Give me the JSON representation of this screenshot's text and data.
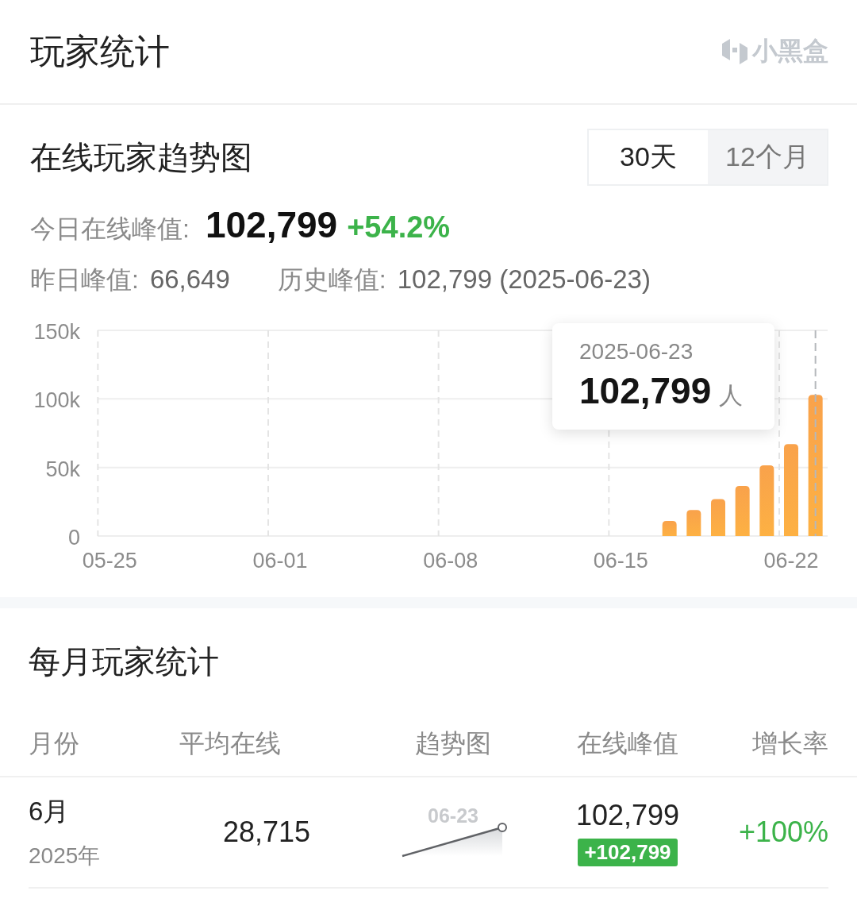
{
  "header": {
    "title": "玩家统计",
    "logo_text": "小黑盒"
  },
  "trend": {
    "title": "在线玩家趋势图",
    "tabs": [
      {
        "label": "30天",
        "selected": true
      },
      {
        "label": "12个月",
        "selected": false
      }
    ],
    "today_label": "今日在线峰值:",
    "today_value": "102,799",
    "today_change": "+54.2%",
    "yesterday_label": "昨日峰值:",
    "yesterday_value": "66,649",
    "record_label": "历史峰值:",
    "record_value": "102,799 (2025-06-23)",
    "chart_data": {
      "type": "bar",
      "categories": [
        "05-25",
        null,
        null,
        null,
        null,
        null,
        null,
        "06-01",
        null,
        null,
        null,
        null,
        null,
        null,
        "06-08",
        null,
        null,
        null,
        null,
        null,
        null,
        "06-15",
        null,
        null,
        null,
        null,
        null,
        null,
        "06-22",
        null
      ],
      "series": [
        {
          "color": "#f9a24b",
          "values": [
            null,
            null,
            null,
            null,
            null,
            null,
            null,
            null,
            null,
            null,
            null,
            null,
            null,
            null,
            null,
            null,
            null,
            null,
            null,
            null,
            null,
            null,
            null,
            11000,
            19000,
            27000,
            36500,
            51500,
            67000,
            103000
          ]
        }
      ],
      "grid": true,
      "ylim": [
        0,
        150000
      ],
      "yticks": [
        {
          "value": 0,
          "label": "0"
        },
        {
          "value": 50000,
          "label": "50k"
        },
        {
          "value": 100000,
          "label": "100k"
        },
        {
          "value": 150000,
          "label": "150k"
        }
      ],
      "stacked": false
    },
    "tooltip": {
      "date": "2025-06-23",
      "value": "102,799",
      "unit": "人"
    }
  },
  "monthly": {
    "title": "每月玩家统计",
    "columns": [
      "月份",
      "平均在线",
      "趋势图",
      "在线峰值",
      "增长率"
    ],
    "rows": [
      {
        "month": "6月",
        "year": "2025年",
        "average": "28,715",
        "trend_label": "06-23",
        "peak": "102,799",
        "peak_change": "+102,799",
        "growth": "+100%"
      }
    ]
  }
}
